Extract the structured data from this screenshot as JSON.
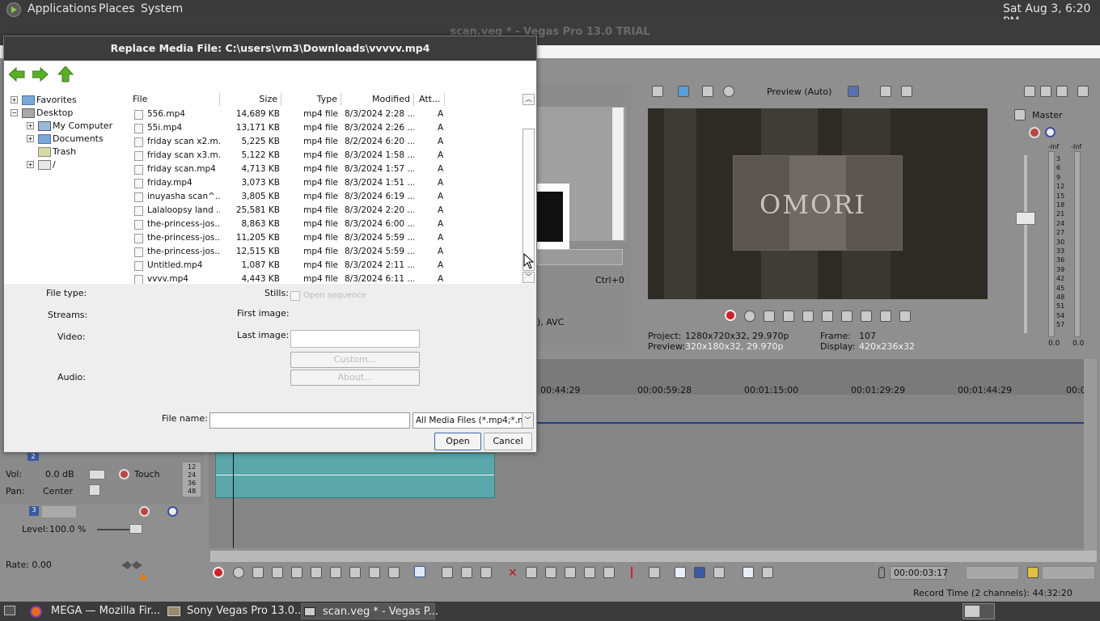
{
  "top_panel": {
    "applications": "Applications",
    "places": "Places",
    "system": "System",
    "clock": "Sat Aug  3,  6:20 PM"
  },
  "vegas": {
    "title": "scan.veg * - Vegas Pro 13.0 TRIAL",
    "preview_mode": "Preview (Auto)",
    "master_label": "Master",
    "shortcut": "Ctrl+0",
    "codec_text": "), AVC",
    "project_label": "Project:",
    "project_value": "1280x720x32, 29.970p",
    "preview_label": "Preview:",
    "preview_value": "320x180x32, 29.970p",
    "frame_label": "Frame:",
    "frame_value": "107",
    "display_label": "Display:",
    "display_value": "420x236x32",
    "overlay_text": "OMORI",
    "meter_top": [
      "-Inf",
      "-Inf"
    ],
    "meter_scale": [
      "3",
      "6",
      "9",
      "12",
      "15",
      "18",
      "21",
      "24",
      "27",
      "30",
      "33",
      "36",
      "39",
      "42",
      "45",
      "48",
      "51",
      "54",
      "57"
    ],
    "meter_bottom": [
      "0.0",
      "0.0"
    ],
    "timeline_marks": [
      "00:44:29",
      "00:00:59:28",
      "00:01:15:00",
      "00:01:29:29",
      "00:01:44:29",
      "00:0"
    ],
    "track2": {
      "vol_label": "Vol:",
      "vol_value": "0.0 dB",
      "touch": "Touch",
      "pan_label": "Pan:",
      "pan_value": "Center",
      "number": "2",
      "meter_ticks": [
        "12",
        "24",
        "36",
        "48"
      ]
    },
    "track3": {
      "number": "3",
      "level_label": "Level:",
      "level_value": "100.0 %"
    },
    "rate_label": "Rate: 0.00",
    "timecode": "00:00:03:17",
    "record_time": "Record Time (2 channels): 44:32:20"
  },
  "dialog": {
    "title": "Replace Media File: C:\\users\\vm3\\Downloads\\vvvvv.mp4",
    "tree": [
      {
        "label": "Favorites"
      },
      {
        "label": "Desktop"
      },
      {
        "label": "My Computer"
      },
      {
        "label": "Documents"
      },
      {
        "label": "Trash"
      },
      {
        "label": "/"
      }
    ],
    "columns": {
      "file": "File",
      "size": "Size",
      "type": "Type",
      "modified": "Modified",
      "attr": "Att..."
    },
    "files": [
      {
        "name": "556.mp4",
        "size": "14,689 KB",
        "type": "mp4 file",
        "modified": "8/3/2024 2:28 ...",
        "attr": "A"
      },
      {
        "name": "55i.mp4",
        "size": "13,171 KB",
        "type": "mp4 file",
        "modified": "8/3/2024 2:26 ...",
        "attr": "A"
      },
      {
        "name": "friday scan x2.m...",
        "size": "5,225 KB",
        "type": "mp4 file",
        "modified": "8/2/2024 6:20 ...",
        "attr": "A"
      },
      {
        "name": "friday scan x3.m...",
        "size": "5,122 KB",
        "type": "mp4 file",
        "modified": "8/3/2024 1:58 ...",
        "attr": "A"
      },
      {
        "name": "friday scan.mp4",
        "size": "4,713 KB",
        "type": "mp4 file",
        "modified": "8/3/2024 1:57 ...",
        "attr": "A"
      },
      {
        "name": "friday.mp4",
        "size": "3,073 KB",
        "type": "mp4 file",
        "modified": "8/3/2024 1:51 ...",
        "attr": "A"
      },
      {
        "name": "inuyasha scan^...",
        "size": "3,805 KB",
        "type": "mp4 file",
        "modified": "8/3/2024 6:19 ...",
        "attr": "A"
      },
      {
        "name": "Lalaloopsy land ...",
        "size": "25,581 KB",
        "type": "mp4 file",
        "modified": "8/3/2024 2:20 ...",
        "attr": "A"
      },
      {
        "name": "the-princess-jos...",
        "size": "8,863 KB",
        "type": "mp4 file",
        "modified": "8/3/2024 6:00 ...",
        "attr": "A"
      },
      {
        "name": "the-princess-jos...",
        "size": "11,205 KB",
        "type": "mp4 file",
        "modified": "8/3/2024 5:59 ...",
        "attr": "A"
      },
      {
        "name": "the-princess-jos...",
        "size": "12,515 KB",
        "type": "mp4 file",
        "modified": "8/3/2024 5:59 ...",
        "attr": "A"
      },
      {
        "name": "Untitled.mp4",
        "size": "1,087 KB",
        "type": "mp4 file",
        "modified": "8/3/2024 2:11 ...",
        "attr": "A"
      },
      {
        "name": "vvvv.mp4",
        "size": "4,443 KB",
        "type": "mp4 file",
        "modified": "8/3/2024 6:11 ...",
        "attr": "A"
      }
    ],
    "file_type_label": "File type:",
    "stills_label": "Stills:",
    "open_sequence": "Open sequence",
    "streams_label": "Streams:",
    "first_image_label": "First image:",
    "video_label": "Video:",
    "last_image_label": "Last image:",
    "custom_button": "Custom...",
    "about_button": "About...",
    "audio_label": "Audio:",
    "file_name_label": "File name:",
    "file_name_value": "",
    "filter": "All Media Files (*.mp4;*.m",
    "open_button": "Open",
    "cancel_button": "Cancel"
  },
  "taskbar": {
    "items": [
      {
        "label": "MEGA — Mozilla Fir..."
      },
      {
        "label": "Sony Vegas Pro 13.0..."
      },
      {
        "label": "scan.veg * - Vegas P..."
      }
    ]
  },
  "colors": {
    "panel_dark": "#3b3b3b",
    "dialog_bg": "#eeeeee",
    "audio_clip": "#5aa6a8",
    "record_red": "#d0202a"
  }
}
